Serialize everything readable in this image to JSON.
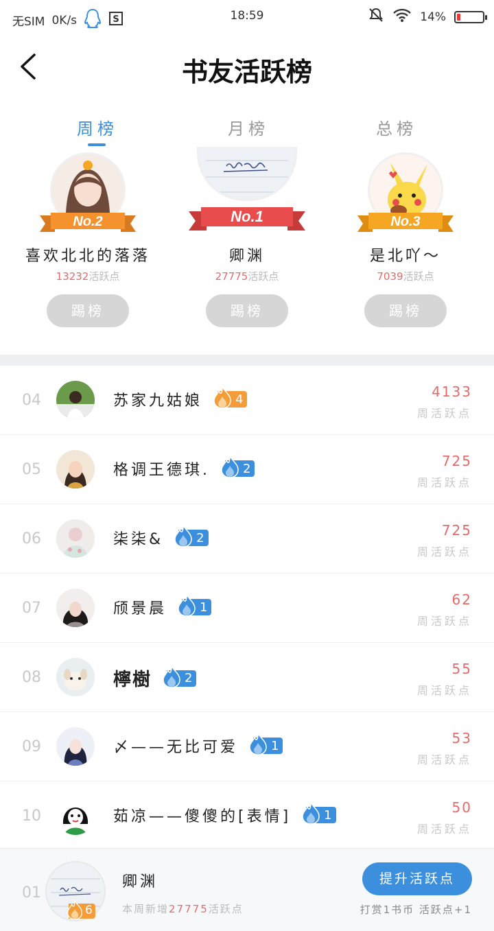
{
  "status_bar": {
    "carrier": "无SIM",
    "speed": "0K/s",
    "time": "18:59",
    "battery": "14%",
    "battery_level": 0.14,
    "icons": [
      "qq-icon",
      "sim-app-icon",
      "mute-icon",
      "wifi-icon",
      "battery-icon"
    ]
  },
  "header": {
    "title": "书友活跃榜",
    "back_icon": "back-arrow-icon"
  },
  "tabs": [
    {
      "label": "周榜",
      "active": true
    },
    {
      "label": "月榜",
      "active": false
    },
    {
      "label": "总榜",
      "active": false
    }
  ],
  "podium": [
    {
      "rank_label": "No.1",
      "name": "卿渊",
      "points": "27775",
      "points_suffix": "活跃点",
      "button": "踢榜",
      "ribbon_color": "#e84c4c"
    },
    {
      "rank_label": "No.2",
      "name": "喜欢北北的落落",
      "points": "13232",
      "points_suffix": "活跃点",
      "button": "踢榜",
      "ribbon_color": "#f5922e"
    },
    {
      "rank_label": "No.3",
      "name": "是北吖～",
      "points": "7039",
      "points_suffix": "活跃点",
      "button": "踢榜",
      "ribbon_color": "#f5a623"
    }
  ],
  "list": [
    {
      "rank": "04",
      "name": "苏家九姑娘",
      "level": "4",
      "badge_color": "orange",
      "score": "4133",
      "score_label": "周活跃点"
    },
    {
      "rank": "05",
      "name": "格调王德琪.",
      "level": "2",
      "badge_color": "blue",
      "score": "725",
      "score_label": "周活跃点"
    },
    {
      "rank": "06",
      "name": "柒柒&",
      "level": "2",
      "badge_color": "blue",
      "score": "725",
      "score_label": "周活跃点"
    },
    {
      "rank": "07",
      "name": "颀景晨",
      "level": "1",
      "badge_color": "blue",
      "score": "62",
      "score_label": "周活跃点"
    },
    {
      "rank": "08",
      "name": "檸樹",
      "level": "2",
      "badge_color": "blue",
      "score": "55",
      "score_label": "周活跃点"
    },
    {
      "rank": "09",
      "name": "〆——无比可爱",
      "level": "1",
      "badge_color": "blue",
      "score": "53",
      "score_label": "周活跃点"
    },
    {
      "rank": "10",
      "name": "茹凉——傻傻的[表情]",
      "level": "1",
      "badge_color": "blue",
      "score": "50",
      "score_label": "周活跃点"
    }
  ],
  "me": {
    "rank": "01",
    "name": "卿渊",
    "level": "6",
    "week_prefix": "本周新增",
    "week_points": "27775",
    "week_suffix": "活跃点",
    "boost_button": "提升活跃点",
    "tip": "打赏1书币 活跃点+1"
  }
}
